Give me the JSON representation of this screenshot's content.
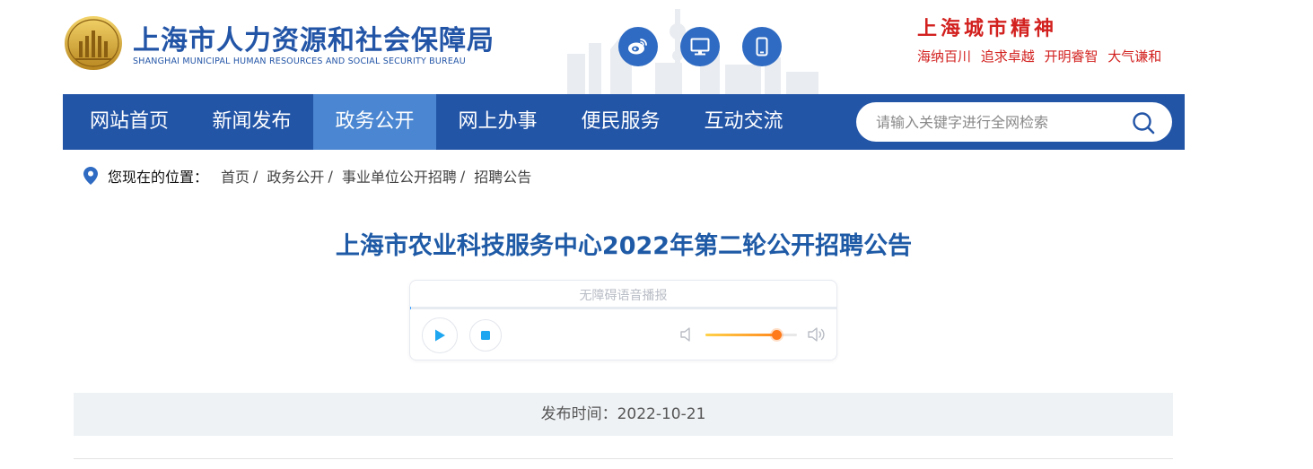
{
  "header": {
    "site_title": "上海市人力资源和社会保障局",
    "site_subtitle": "SHANGHAI MUNICIPAL HUMAN RESOURCES AND SOCIAL SECURITY BUREAU",
    "social_icons": [
      "weibo-icon",
      "desktop-icon",
      "mobile-icon"
    ],
    "spirit_title": "上海城市精神",
    "spirit_motto": "海纳百川 追求卓越 开明睿智 大气谦和"
  },
  "nav": {
    "items": [
      {
        "label": "网站首页"
      },
      {
        "label": "新闻发布"
      },
      {
        "label": "政务公开",
        "active": true
      },
      {
        "label": "网上办事"
      },
      {
        "label": "便民服务"
      },
      {
        "label": "互动交流"
      }
    ],
    "search_placeholder": "请输入关键字进行全网检索"
  },
  "breadcrumb": {
    "label": "您现在的位置：",
    "items": [
      "首页",
      "政务公开",
      "事业单位公开招聘",
      "招聘公告"
    ],
    "separator": "/"
  },
  "article": {
    "title": "上海市农业科技服务中心2022年第二轮公开招聘公告",
    "publish_time": "发布时间：2022-10-21"
  },
  "player": {
    "title": "无障碍语音播报",
    "progress": 0.003,
    "volume": 0.77
  },
  "colors": {
    "brand_blue": "#2355a7",
    "nav_active": "#4a86d1",
    "title_blue": "#1e5aa6",
    "spirit_red": "#d2211f",
    "volume_orange": "#ff7a1a"
  }
}
